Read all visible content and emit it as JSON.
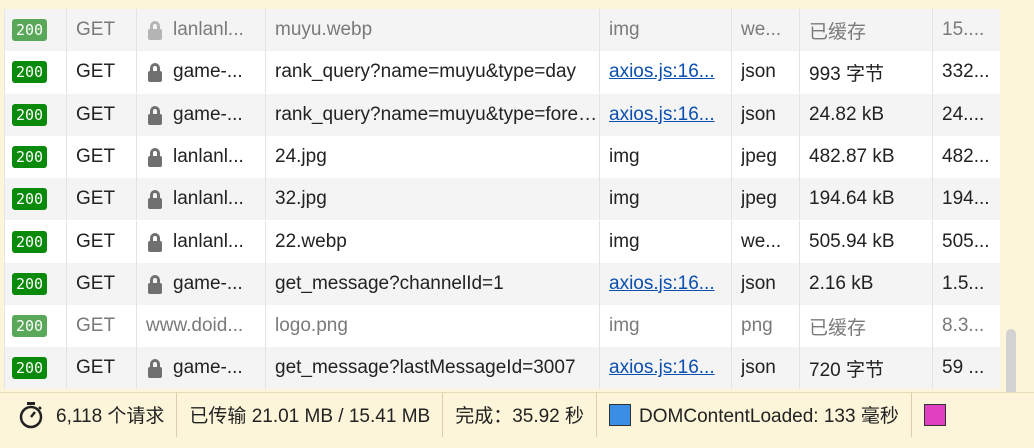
{
  "requests": [
    {
      "status": "200",
      "method": "GET",
      "domain": "lanlanl...",
      "file": "muyu.webp",
      "initiator": "img",
      "initiator_link": false,
      "type": "we...",
      "size": "已缓存",
      "time": "15....",
      "cached": true
    },
    {
      "status": "200",
      "method": "GET",
      "domain": "game-...",
      "file": "rank_query?name=muyu&type=day",
      "initiator": "axios.js:16...",
      "initiator_link": true,
      "type": "json",
      "size": "993 字节",
      "time": "332...",
      "cached": false
    },
    {
      "status": "200",
      "method": "GET",
      "domain": "game-...",
      "file": "rank_query?name=muyu&type=forever",
      "initiator": "axios.js:16...",
      "initiator_link": true,
      "type": "json",
      "size": "24.82 kB",
      "time": "24....",
      "cached": false
    },
    {
      "status": "200",
      "method": "GET",
      "domain": "lanlanl...",
      "file": "24.jpg",
      "initiator": "img",
      "initiator_link": false,
      "type": "jpeg",
      "size": "482.87 kB",
      "time": "482...",
      "cached": false
    },
    {
      "status": "200",
      "method": "GET",
      "domain": "lanlanl...",
      "file": "32.jpg",
      "initiator": "img",
      "initiator_link": false,
      "type": "jpeg",
      "size": "194.64 kB",
      "time": "194...",
      "cached": false
    },
    {
      "status": "200",
      "method": "GET",
      "domain": "lanlanl...",
      "file": "22.webp",
      "initiator": "img",
      "initiator_link": false,
      "type": "we...",
      "size": "505.94 kB",
      "time": "505...",
      "cached": false
    },
    {
      "status": "200",
      "method": "GET",
      "domain": "game-...",
      "file": "get_message?channelId=1",
      "initiator": "axios.js:16...",
      "initiator_link": true,
      "type": "json",
      "size": "2.16 kB",
      "time": "1.5...",
      "cached": false
    },
    {
      "status": "200",
      "method": "GET",
      "domain": "www.doid...",
      "file": "logo.png",
      "initiator": "img",
      "initiator_link": false,
      "type": "png",
      "size": "已缓存",
      "time": "8.3...",
      "cached": true,
      "no_lock": true
    },
    {
      "status": "200",
      "method": "GET",
      "domain": "game-...",
      "file": "get_message?lastMessageId=3007",
      "initiator": "axios.js:16...",
      "initiator_link": true,
      "type": "json",
      "size": "720 字节",
      "time": "59 ...",
      "cached": false
    }
  ],
  "statusbar": {
    "request_count": "6,118 个请求",
    "transferred": "已传输 21.01 MB / 15.41 MB",
    "finish": "完成：35.92 秒",
    "dom_content_loaded": "DOMContentLoaded: 133 毫秒",
    "dcl_color": "#3a8ee6",
    "load_color": "#e040c0"
  }
}
